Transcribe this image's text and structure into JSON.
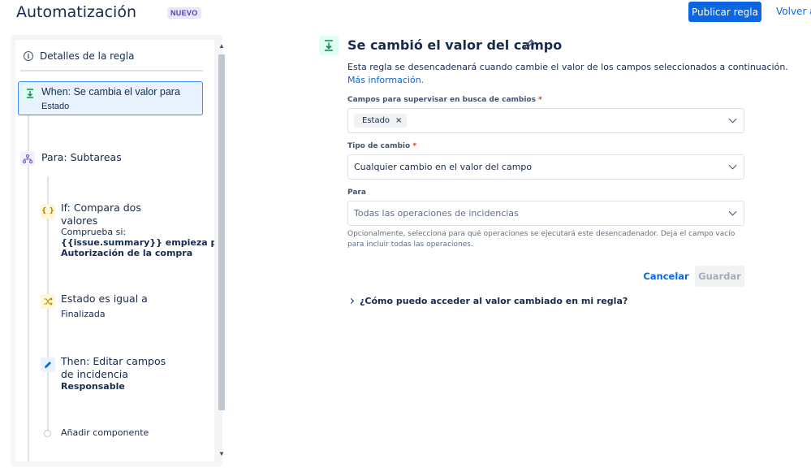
{
  "header": {
    "title": "Automatización",
    "badge": "NUEVO",
    "publish_label": "Publicar regla",
    "back_label": "Volver a"
  },
  "sidebar": {
    "details_label": "Detalles de la regla",
    "when": {
      "title": "When: Se cambia el valor para",
      "sub": "Estado"
    },
    "branch": {
      "title": "Para: Subtareas"
    },
    "condition": {
      "title_line1": "If: Compara dos",
      "title_line2": "valores",
      "sub": "Comprueba si:",
      "bold_line1": "{{issue.summary}} empieza por",
      "bold_line2": "Autorización de la compra"
    },
    "status_condition": {
      "title": "Estado es igual a",
      "sub": "Finalizada"
    },
    "action": {
      "title_line1": "Then: Editar campos",
      "title_line2": "de incidencia",
      "bold": "Responsable"
    },
    "add_component": "Añadir componente"
  },
  "panel": {
    "title": "Se cambió el valor del campo",
    "description": "Esta regla se desencadenará cuando cambie el valor de los campos seleccionados a continuación.",
    "more_info": "Más información.",
    "fields_label": "Campos para supervisar en busca de cambios",
    "fields_chip": "Estado",
    "change_type_label": "Tipo de cambio",
    "change_type_value": "Cualquier cambio en el valor del campo",
    "for_label": "Para",
    "for_placeholder": "Todas las operaciones de incidencias",
    "help_text": "Opcionalmente, selecciona para qué operaciones se ejecutará este desencadenador. Deja el campo vacío para incluir todas las operaciones.",
    "cancel_label": "Cancelar",
    "save_label": "Guardar",
    "faq_label": "¿Cómo puedo acceder al valor cambiado en mi regla?",
    "required_mark": "*",
    "chip_remove": "×"
  },
  "icons": {
    "info": "info-icon",
    "trigger": "field-changed-icon",
    "branch": "branch-icon",
    "condition": "condition-braces-icon",
    "status": "shuffle-icon",
    "edit": "pencil-icon"
  },
  "colors": {
    "primary": "#0c66e4",
    "selected_bg": "#e9f2ff",
    "trigger_bg": "#dcfff1",
    "condition_bg": "#fff7d6",
    "branch_bg": "#f3f0ff"
  }
}
